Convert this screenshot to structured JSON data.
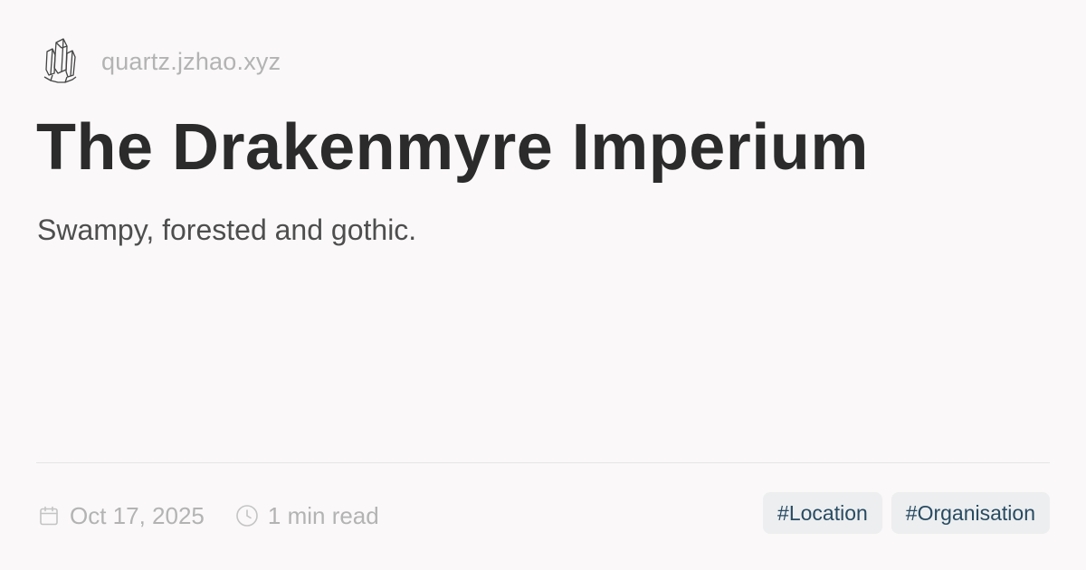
{
  "site": {
    "logo_icon": "crystal-logo",
    "domain": "quartz.jzhao.xyz"
  },
  "page": {
    "title": "The Drakenmyre Imperium",
    "description": "Swampy, forested and gothic."
  },
  "meta": {
    "date_icon": "calendar-icon",
    "date": "Oct 17, 2025",
    "reading_time_icon": "clock-icon",
    "reading_time": "1 min read"
  },
  "tags": [
    {
      "label": "#Location"
    },
    {
      "label": "#Organisation"
    }
  ],
  "colors": {
    "background": "#faf8f8",
    "title": "#2b2b2b",
    "muted": "#b3b3b3",
    "tag_background": "#eceeef",
    "tag_text": "#284b63"
  }
}
